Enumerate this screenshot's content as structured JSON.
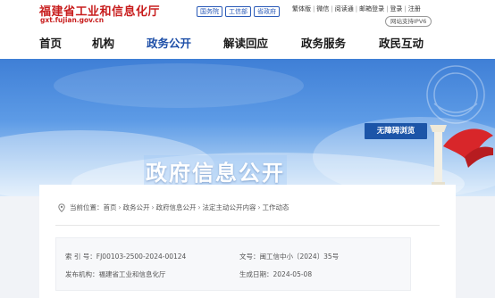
{
  "header": {
    "site_name": "福建省工业和信息化厅",
    "site_url": "gxt.fujian.gov.cn",
    "gov_links": [
      "国务院",
      "工信部",
      "省政府"
    ],
    "util_links": [
      "繁体版",
      "微信",
      "阅读通",
      "邮箱登录",
      "登录",
      "注册"
    ],
    "ipv6_badge": "网站支持IPV6"
  },
  "nav": {
    "items": [
      "首页",
      "机构",
      "政务公开",
      "解读回应",
      "政务服务",
      "政民互动"
    ],
    "active": "政务公开"
  },
  "banner": {
    "title": "政府信息公开",
    "accessibility_button": "无障碍浏览"
  },
  "breadcrumb": {
    "prefix": "当前位置：",
    "items": [
      "首页",
      "政务公开",
      "政府信息公开",
      "法定主动公开内容",
      "工作动态"
    ],
    "separator": "›"
  },
  "meta": {
    "index_label": "索 引 号：",
    "index_value": "FJ00103-2500-2024-00124",
    "doc_no_label": "文号：",
    "doc_no_value": "闽工信中小〔2024〕35号",
    "publisher_label": "发布机构：",
    "publisher_value": "福建省工业和信息化厅",
    "date_label": "生成日期：",
    "date_value": "2024-05-08"
  },
  "colors": {
    "brand_red": "#c81e1e",
    "nav_active": "#1e4fa8",
    "a11y_button": "#1c55a8"
  },
  "icons": {
    "location": "location-pin-icon"
  }
}
